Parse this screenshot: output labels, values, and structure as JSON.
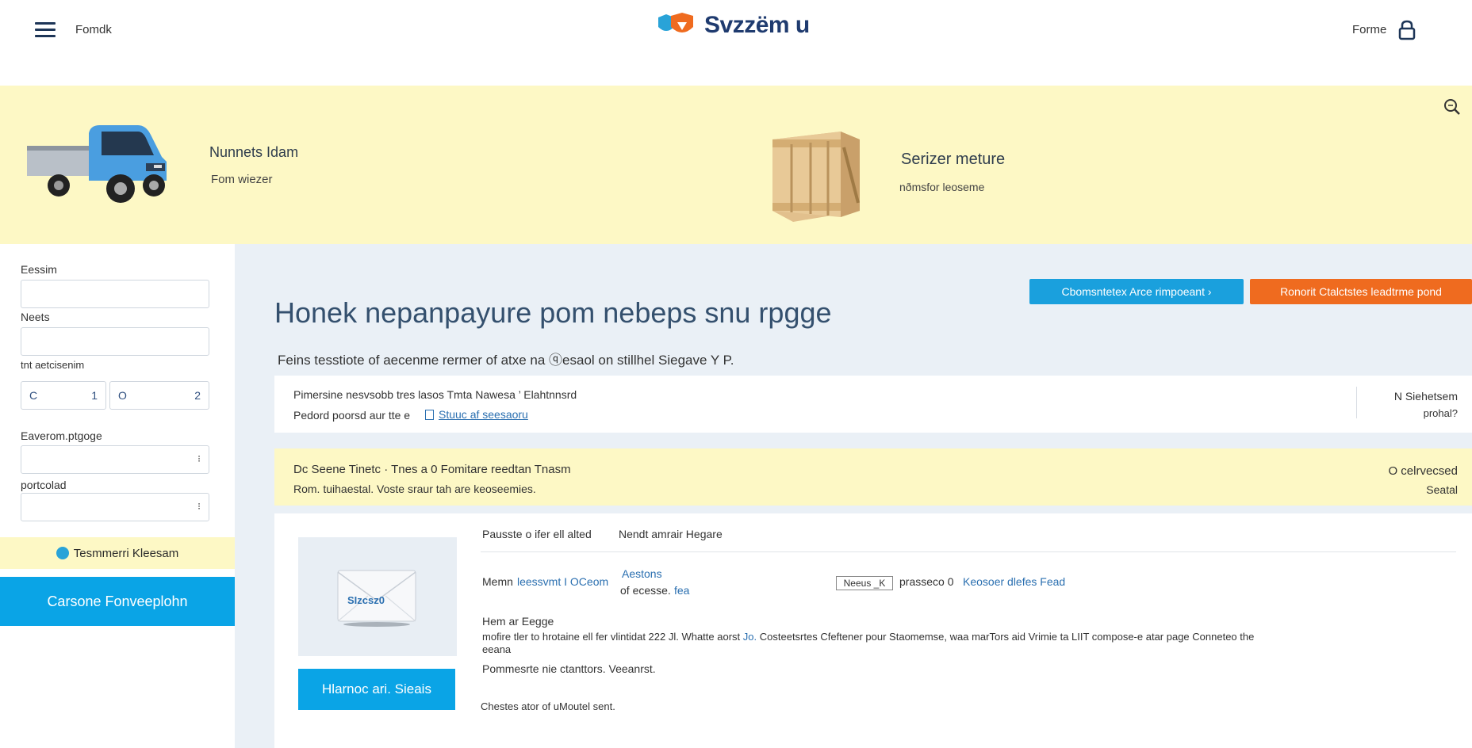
{
  "header": {
    "menu_label": "Fomdk",
    "logo_text": "Svzzёm u",
    "login_label": "Forme",
    "colors": {
      "brand_orange": "#ef6b1f",
      "brand_blue": "#29a3d8",
      "logo_text": "#1f3b6f"
    }
  },
  "banner": {
    "item1_title": "Nunnets Idam",
    "item1_sub": "Fom wiezer",
    "item2_title": "Serizer meture",
    "item2_sub": "nðmsfor leoseme"
  },
  "sidebar": {
    "label1": "Eessim",
    "label2": "Neets",
    "label3": "tnt aetcisenim",
    "range_min_prefix": "C",
    "range_min_suffix": "1",
    "range_max_prefix": "O",
    "range_max_suffix": "2",
    "label4": "Eaverom.ptgoge",
    "label5": "portcolad",
    "highlight_text": "Tesmmerri Kleesam",
    "cta_label": "Carsone Fonveeplohn"
  },
  "main": {
    "btn_blue_label": "Cbomsntetex Arce rimpoeant  ›",
    "btn_orange_label": "Ronorit Ctalctstes leadtrme pond",
    "title": "Honek nepanpayure pom nebeps snu rpgge",
    "description": "Feins tesstiote of aecenme rermer of atxe na ⓠesaol on stillhel Siegave Y P.",
    "card1": {
      "line1": "Pimersine nesvsobb tres lasos  Tmta Nawesa   ’  Elahtnnsrd",
      "line2": "Pedord poorsd aur tte e",
      "link": "Stuuc af seesaoru",
      "right1": "N Siehetsem",
      "right2": "prohal?"
    },
    "card2": {
      "line1": "Dc Seene  Tinetc  ·  Tnes  a  0   Fomitare reedtan Tnasm",
      "line2": "Rom. tuihaestal. Voste sraur tah are keoseemies.",
      "right1": "O celrvecsed",
      "right2": "Seatal"
    },
    "card3": {
      "envelope_text": "SIzcsz0",
      "button_label": "Hlarnoc ari. Sieais",
      "row1_a": "Pausste o ifer ell alted",
      "row1_b": "Nendt amrair Hegare",
      "row2_label": "Memn",
      "row2_link": "leessvmt I OCeom",
      "row2_mid_link": "Aestons",
      "row2_mid_text": "of ecesse.",
      "row2_mid_link2": "fea",
      "mini_box": "Neeus  _K",
      "row2_right_text": "prasseco  0",
      "row2_right_link": "Keosoer dlefes Fead",
      "section_title": "Hem ar  Eegge",
      "para_line1": "mofire tler to hrotaine ell fer vlintidat 222  Jl.  Whatte aorst",
      "para_link": "Jo.",
      "para_line1b": "Costeetsrtes  Cfeftener pour Staomemse, waa marTors aid Vrimie ta LIIT compose-e atar page Conneteo  the",
      "para_line2": "eeana",
      "line3": "Pommesrte nie ctanttors. Veeanrst.",
      "line4": "Chestes ator of uMoutel sent."
    }
  }
}
